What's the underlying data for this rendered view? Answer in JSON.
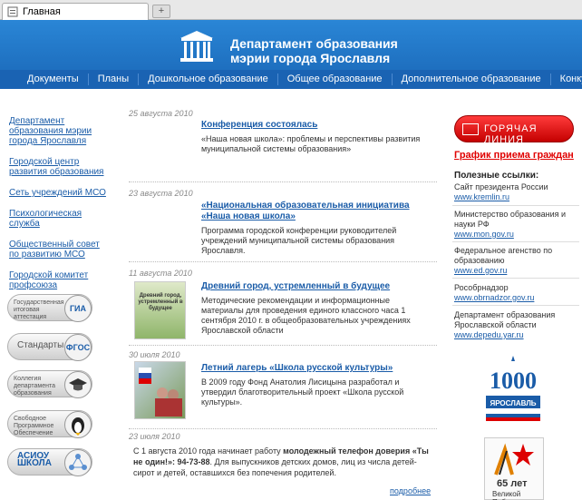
{
  "browser": {
    "tab_title": "Главная",
    "new_tab": "+"
  },
  "header": {
    "title_line1": "Департамент образования",
    "title_line2": "мэрии города Ярославля"
  },
  "nav": [
    "Документы",
    "Планы",
    "Дошкольное образование",
    "Общее образование",
    "Дополнительное образование",
    "Конкурсы"
  ],
  "sidebar": {
    "links": [
      "Департамент образования мэрии города Ярославля",
      "Городской центр развития образования",
      "Сеть учреждений МСО",
      "Психологическая служба",
      "Общественный совет по развитию МСО",
      "Городской комитет профсоюза"
    ],
    "badges": [
      {
        "text": "Государственная итоговая аттестация",
        "circle": "ГИА"
      },
      {
        "text": "Стандарты",
        "circle": "ФГОС"
      },
      {
        "text": "Коллегия департамента образования",
        "circle": ""
      },
      {
        "text": "Свободное Программное Обеспечение",
        "circle": ""
      },
      {
        "text": "АСИОУ ШКОЛА",
        "circle": ""
      }
    ]
  },
  "news": [
    {
      "date": "25 августа 2010",
      "title": "Конференция состоялась",
      "text": "«Наша новая школа»: проблемы и перспективы развития муниципальной системы образования»"
    },
    {
      "date": "23 августа 2010",
      "title": "«Национальная образовательная инициатива «Наша новая школа»",
      "text": "Программа городской конференции руководителей учреждений муниципальной системы образования Ярославля."
    },
    {
      "date": "11 августа 2010",
      "title": "Древний город, устремленный в будущее",
      "text": "Методические рекомендации и информационные материалы для проведения единого классного часа 1 сентября 2010 г. в общеобразовательных учреждениях Ярославской области",
      "thumb": "Древний город, устремленный в будущее"
    },
    {
      "date": "30 июля 2010",
      "title": "Летний лагерь «Школа русской культуры»",
      "text": "В 2009 году Фонд Анатолия Лисицына разработал и утвердил благотворительный проект «Школа русской культуры»."
    },
    {
      "date": "23 июля 2010",
      "text_before": "С 1 августа 2010 года начинает работу ",
      "text_bold": "молодежный телефон доверия «Ты не один!»: 94-73-88",
      "text_after": ". Для выпускников детских домов, лиц из числа детей-сирот и детей, оставшихся без попечения родителей.",
      "more": "подробнее"
    }
  ],
  "right": {
    "hotline": "ГОРЯЧАЯ ЛИНИЯ",
    "schedule": "График приема граждан",
    "useful_title": "Полезные ссылки:",
    "links": [
      {
        "name": "Сайт президента России",
        "url": "www.kremlin.ru"
      },
      {
        "name": "Министерство образования и науки РФ",
        "url": "www.mon.gov.ru"
      },
      {
        "name": "Федеральное агенство по образованию",
        "url": "www.ed.gov.ru"
      },
      {
        "name": "Рособрнадзор",
        "url": "www.obrnadzor.gov.ru"
      },
      {
        "name": "Департамент образования Ярославской области",
        "url": "www.depedu.yar.ru"
      }
    ],
    "y1000_text": "ЯРОСЛАВЛЬ",
    "victory_num": "65 лет",
    "victory_sub": "Великой Победе"
  },
  "colors": {
    "header": "#2a86d6",
    "nav": "#1a63b3",
    "link": "#1a5ca8",
    "hotline": "#e00000"
  }
}
